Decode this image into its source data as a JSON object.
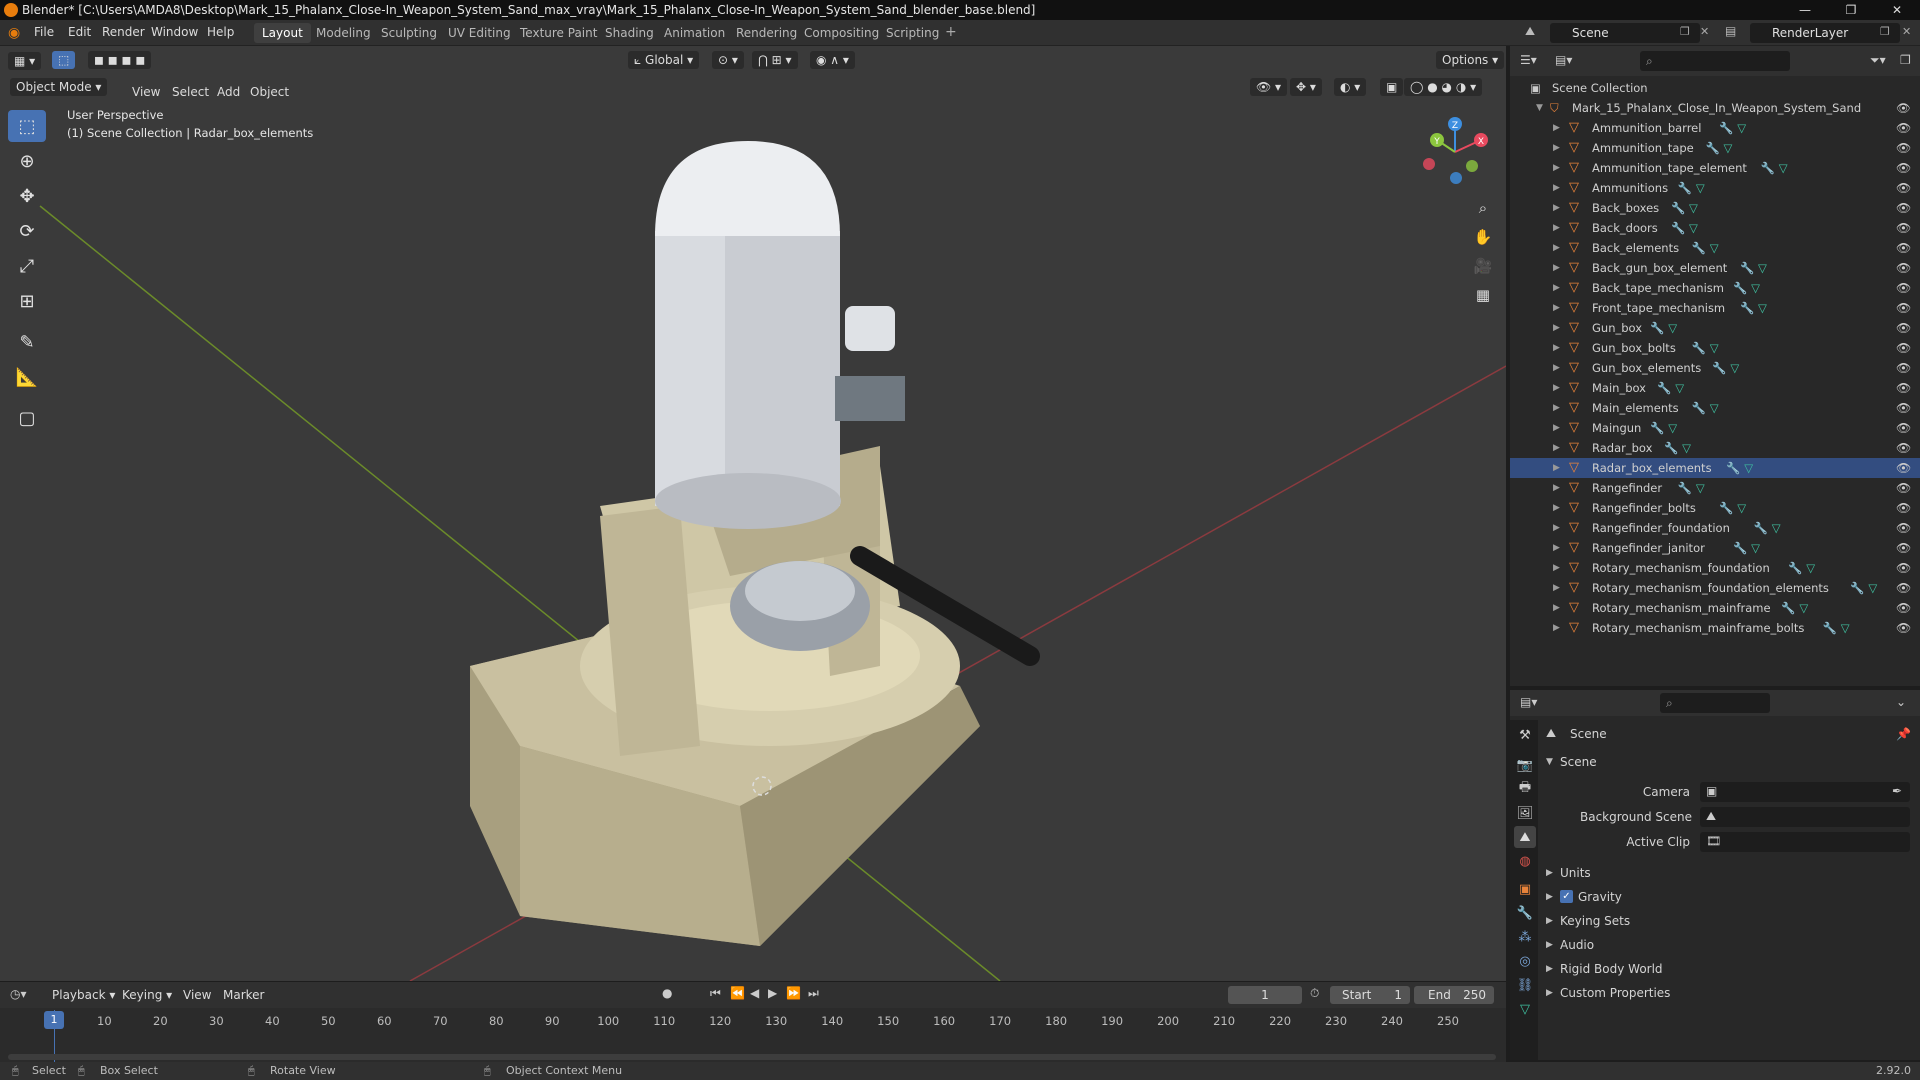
{
  "window": {
    "title": "Blender* [C:\\Users\\AMDA8\\Desktop\\Mark_15_Phalanx_Close-In_Weapon_System_Sand_max_vray\\Mark_15_Phalanx_Close-In_Weapon_System_Sand_blender_base.blend]"
  },
  "menubar": [
    "File",
    "Edit",
    "Render",
    "Window",
    "Help"
  ],
  "workspaces": [
    "Layout",
    "Modeling",
    "Sculpting",
    "UV Editing",
    "Texture Paint",
    "Shading",
    "Animation",
    "Rendering",
    "Compositing",
    "Scripting"
  ],
  "active_workspace": "Layout",
  "scene_field": "Scene",
  "renderlayer_field": "RenderLayer",
  "viewport": {
    "transform_orientation": "Global",
    "options_label": "Options",
    "mode": "Object Mode",
    "menus": [
      "View",
      "Select",
      "Add",
      "Object"
    ],
    "perspective_label": "User Perspective",
    "collection_label": "(1) Scene Collection | Radar_box_elements",
    "gizmo_axes": [
      "X",
      "Y",
      "Z"
    ]
  },
  "outliner": {
    "root": "Scene Collection",
    "collection": "Mark_15_Phalanx_Close_In_Weapon_System_Sand",
    "objects": [
      "Ammunition_barrel",
      "Ammunition_tape",
      "Ammunition_tape_element",
      "Ammunitions",
      "Back_boxes",
      "Back_doors",
      "Back_elements",
      "Back_gun_box_element",
      "Back_tape_mechanism",
      "Front_tape_mechanism",
      "Gun_box",
      "Gun_box_bolts",
      "Gun_box_elements",
      "Main_box",
      "Main_elements",
      "Maingun",
      "Radar_box",
      "Radar_box_elements",
      "Rangefinder",
      "Rangefinder_bolts",
      "Rangefinder_foundation",
      "Rangefinder_janitor",
      "Rotary_mechanism_foundation",
      "Rotary_mechanism_foundation_elements",
      "Rotary_mechanism_mainframe",
      "Rotary_mechanism_mainframe_bolts"
    ],
    "selected": "Radar_box_elements"
  },
  "properties": {
    "context": "Scene",
    "panel": "Scene",
    "fields": [
      {
        "label": "Camera"
      },
      {
        "label": "Background Scene"
      },
      {
        "label": "Active Clip"
      }
    ],
    "subpanels": [
      "Units",
      "Gravity",
      "Keying Sets",
      "Audio",
      "Rigid Body World",
      "Custom Properties"
    ],
    "gravity_checked": true
  },
  "timeline": {
    "menus": [
      "Playback",
      "Keying",
      "View",
      "Marker"
    ],
    "current_frame": "1",
    "start_label": "Start",
    "start": "1",
    "end_label": "End",
    "end": "250",
    "ticks": [
      "1",
      "10",
      "20",
      "30",
      "40",
      "50",
      "60",
      "70",
      "80",
      "90",
      "100",
      "110",
      "120",
      "130",
      "140",
      "150",
      "160",
      "170",
      "180",
      "190",
      "200",
      "210",
      "220",
      "230",
      "240",
      "250"
    ]
  },
  "statusbar": {
    "items": [
      "Select",
      "Box Select",
      "Rotate View",
      "Object Context Menu"
    ],
    "version": "2.92.0"
  },
  "colors": {
    "accent": "#4772b3",
    "selection": "#334d80",
    "mesh_icon": "#e8833a",
    "axis_x": "#e84a5f",
    "axis_y": "#8cc63e",
    "axis_z": "#3d8fe0"
  }
}
